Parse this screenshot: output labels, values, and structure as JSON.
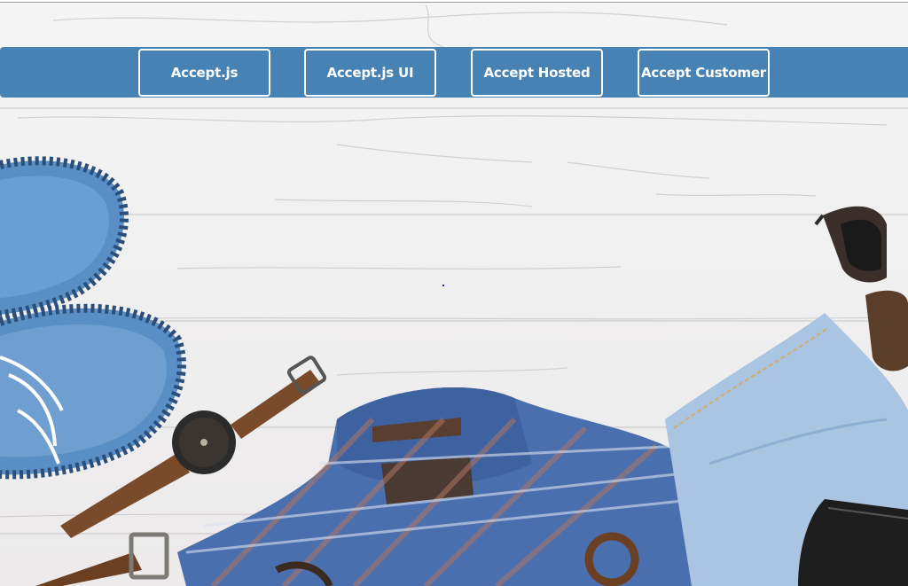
{
  "nav": {
    "buttons": [
      {
        "label": "Accept.js"
      },
      {
        "label": "Accept.js UI"
      },
      {
        "label": "Accept Hosted"
      },
      {
        "label": "Accept Customer"
      }
    ]
  },
  "hero": {
    "items": [
      "shoes",
      "wristwatch",
      "plaid-shirt",
      "denim-jeans",
      "sunglasses",
      "leather-belt",
      "wallet"
    ]
  },
  "colors": {
    "nav_bar": "#4682b4",
    "button_border": "#ffffff",
    "button_text": "#ffffff",
    "background": "#f2f1f1"
  }
}
